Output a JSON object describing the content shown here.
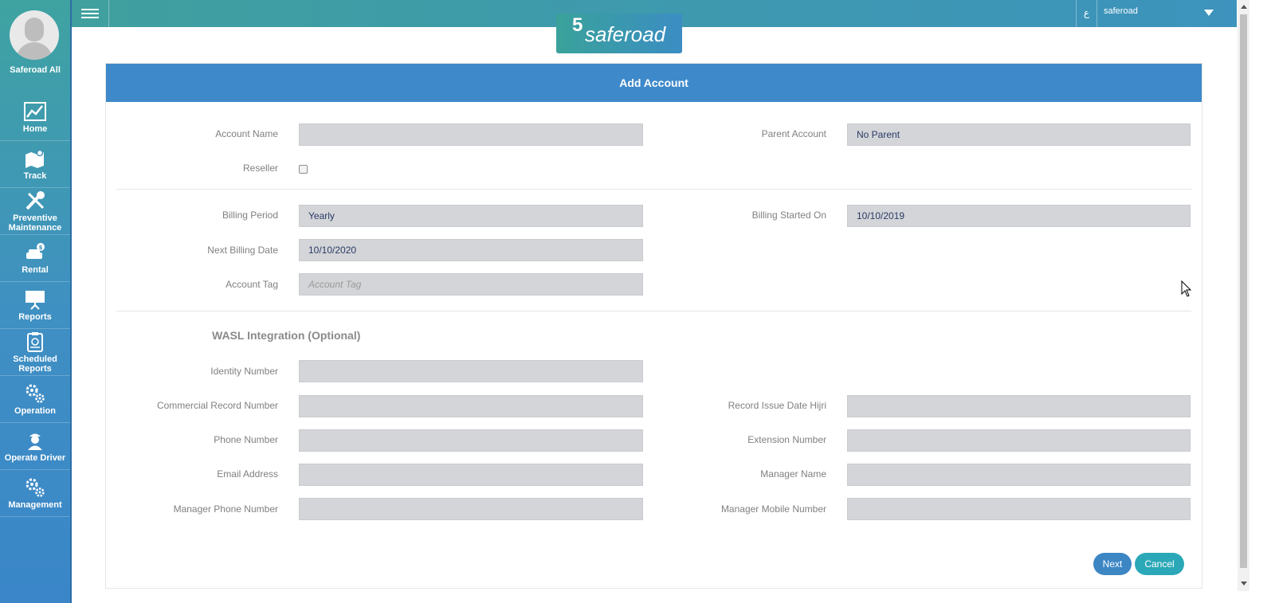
{
  "user": {
    "name": "Saferoad All"
  },
  "nav": [
    {
      "label": "Home",
      "icon": "chart-icon"
    },
    {
      "label": "Track",
      "icon": "map-icon"
    },
    {
      "label": "Preventive Maintenance",
      "icon": "wrench-icon"
    },
    {
      "label": "Rental",
      "icon": "car-icon"
    },
    {
      "label": "Reports",
      "icon": "presentation-icon"
    },
    {
      "label": "Scheduled Reports",
      "icon": "clipboard-icon"
    },
    {
      "label": "Operation",
      "icon": "gears-icon"
    },
    {
      "label": "Operate Driver",
      "icon": "driver-icon"
    },
    {
      "label": "Management",
      "icon": "gears-icon"
    }
  ],
  "topbar": {
    "lang": "ع",
    "account": "saferoad"
  },
  "logo": {
    "mark": "5",
    "text": "saferoad"
  },
  "form": {
    "title": "Add Account",
    "account_name": {
      "label": "Account Name",
      "value": ""
    },
    "parent_account": {
      "label": "Parent Account",
      "value": "No Parent"
    },
    "reseller": {
      "label": "Reseller"
    },
    "billing_period": {
      "label": "Billing Period",
      "value": "Yearly"
    },
    "billing_started_on": {
      "label": "Billing Started On",
      "value": "10/10/2019"
    },
    "next_billing_date": {
      "label": "Next Billing Date",
      "value": "10/10/2020"
    },
    "account_tag": {
      "label": "Account Tag",
      "placeholder": "Account Tag"
    },
    "wasl_title": "WASL Integration (Optional)",
    "identity_number": {
      "label": "Identity Number"
    },
    "commercial_record_number": {
      "label": "Commercial Record Number"
    },
    "record_issue_date_hijri": {
      "label": "Record Issue Date Hijri"
    },
    "phone_number": {
      "label": "Phone Number"
    },
    "extension_number": {
      "label": "Extension Number"
    },
    "email_address": {
      "label": "Email Address"
    },
    "manager_name": {
      "label": "Manager Name"
    },
    "manager_phone_number": {
      "label": "Manager Phone Number"
    },
    "manager_mobile_number": {
      "label": "Manager Mobile Number"
    },
    "next_label": "Next",
    "cancel_label": "Cancel"
  }
}
